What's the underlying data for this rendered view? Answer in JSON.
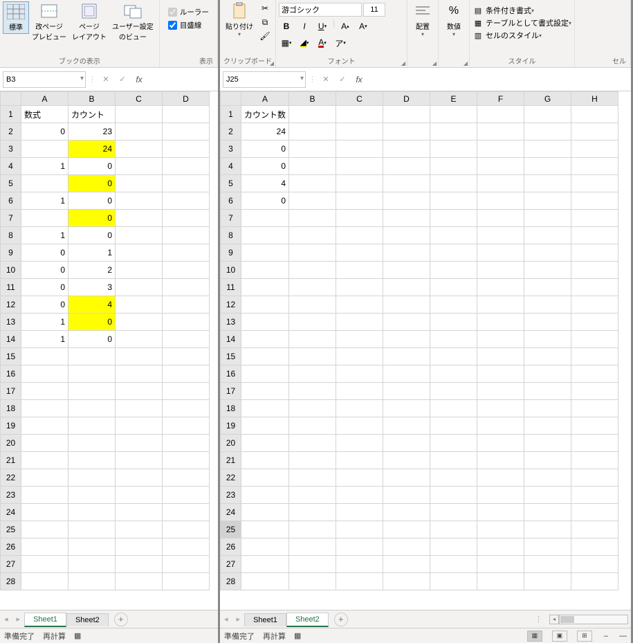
{
  "left": {
    "ribbon": {
      "view_group": {
        "buttons": [
          "標準",
          "改ページ\nプレビュー",
          "ページ\nレイアウト",
          "ユーザー設定\nのビュー"
        ],
        "label": "ブックの表示"
      },
      "show_group": {
        "ruler": "ルーラー",
        "gridlines": "目盛線",
        "label": "表示"
      }
    },
    "namebox": "B3",
    "columns": [
      "A",
      "B",
      "C",
      "D"
    ],
    "rows": [
      {
        "n": 1,
        "a": "数式",
        "b": "カウント",
        "a_left": true,
        "b_left": true
      },
      {
        "n": 2,
        "a": "0",
        "b": "23"
      },
      {
        "n": 3,
        "a": "",
        "b": "24",
        "hl": true
      },
      {
        "n": 4,
        "a": "1",
        "b": "0"
      },
      {
        "n": 5,
        "a": "",
        "b": "0",
        "hl": true
      },
      {
        "n": 6,
        "a": "1",
        "b": "0"
      },
      {
        "n": 7,
        "a": "",
        "b": "0",
        "hl": true
      },
      {
        "n": 8,
        "a": "1",
        "b": "0"
      },
      {
        "n": 9,
        "a": "0",
        "b": "1"
      },
      {
        "n": 10,
        "a": "0",
        "b": "2"
      },
      {
        "n": 11,
        "a": "0",
        "b": "3"
      },
      {
        "n": 12,
        "a": "0",
        "b": "4",
        "hl": true
      },
      {
        "n": 13,
        "a": "1",
        "b": "0",
        "hl": true
      },
      {
        "n": 14,
        "a": "1",
        "b": "0"
      },
      {
        "n": 15
      },
      {
        "n": 16
      },
      {
        "n": 17
      },
      {
        "n": 18
      },
      {
        "n": 19
      },
      {
        "n": 20
      },
      {
        "n": 21
      },
      {
        "n": 22
      },
      {
        "n": 23
      },
      {
        "n": 24
      },
      {
        "n": 25
      },
      {
        "n": 26
      },
      {
        "n": 27
      },
      {
        "n": 28
      }
    ],
    "sheets": {
      "s1": "Sheet1",
      "s2": "Sheet2",
      "active": "Sheet1"
    },
    "status": {
      "ready": "準備完了",
      "recalc": "再計算"
    }
  },
  "right": {
    "ribbon": {
      "clipboard": {
        "paste": "貼り付け",
        "label": "クリップボード"
      },
      "font": {
        "name": "游ゴシック",
        "size": "11",
        "label": "フォント"
      },
      "align": {
        "label": "配置",
        "btn": "配置"
      },
      "number": {
        "label": "数値",
        "btn": "数値"
      },
      "styles": {
        "cond": "条件付き書式",
        "table": "テーブルとして書式設定",
        "cell": "セルのスタイル",
        "label": "スタイル"
      },
      "cells": {
        "label": "セル"
      }
    },
    "namebox": "J25",
    "columns": [
      "A",
      "B",
      "C",
      "D",
      "E",
      "F",
      "G",
      "H"
    ],
    "rows": [
      {
        "n": 1,
        "a": "カウント数",
        "a_left": true
      },
      {
        "n": 2,
        "a": "24"
      },
      {
        "n": 3,
        "a": "0"
      },
      {
        "n": 4,
        "a": "0"
      },
      {
        "n": 5,
        "a": "4"
      },
      {
        "n": 6,
        "a": "0"
      },
      {
        "n": 7
      },
      {
        "n": 8
      },
      {
        "n": 9
      },
      {
        "n": 10
      },
      {
        "n": 11
      },
      {
        "n": 12
      },
      {
        "n": 13
      },
      {
        "n": 14
      },
      {
        "n": 15
      },
      {
        "n": 16
      },
      {
        "n": 17
      },
      {
        "n": 18
      },
      {
        "n": 19
      },
      {
        "n": 20
      },
      {
        "n": 21
      },
      {
        "n": 22
      },
      {
        "n": 23
      },
      {
        "n": 24
      },
      {
        "n": 25
      },
      {
        "n": 26
      },
      {
        "n": 27
      },
      {
        "n": 28
      }
    ],
    "sheets": {
      "s1": "Sheet1",
      "s2": "Sheet2",
      "active": "Sheet2"
    },
    "status": {
      "ready": "準備完了",
      "recalc": "再計算"
    }
  }
}
